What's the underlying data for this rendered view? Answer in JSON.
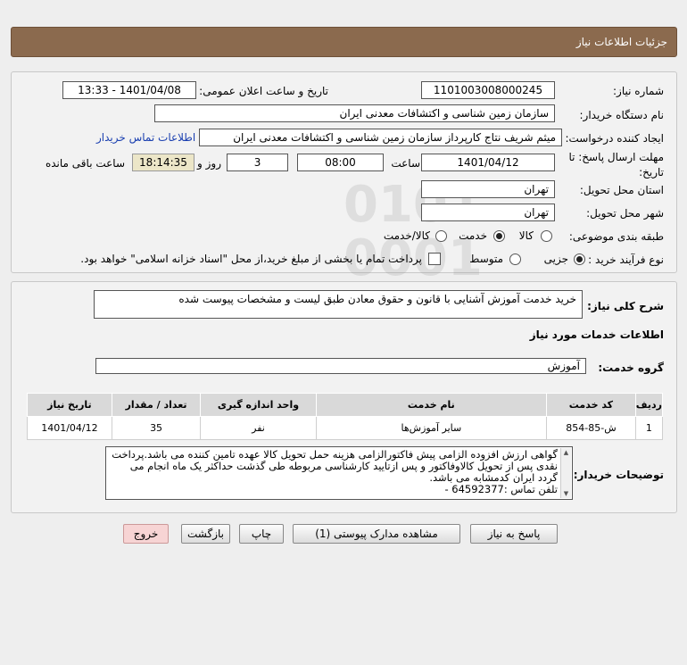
{
  "header": {
    "title": "جزئیات اطلاعات نیاز"
  },
  "need": {
    "number_label": "شماره نیاز:",
    "number": "1101003008000245",
    "announce_label": "تاریخ و ساعت اعلان عمومی:",
    "announce": "1401/04/08 - 13:33",
    "buyer_label": "نام دستگاه خریدار:",
    "buyer": "سازمان زمین شناسی و اکتشافات معدنی ایران",
    "creator_label": "ایجاد کننده درخواست:",
    "creator": "میثم شریف نتاج کارپرداز سازمان زمین شناسی و اکتشافات معدنی ایران",
    "contact_link": "اطلاعات تماس خریدار",
    "deadline_label_1": "مهلت ارسال پاسخ: تا",
    "deadline_label_2": "تاریخ:",
    "deadline_date": "1401/04/12",
    "time_label": "ساعت",
    "deadline_time": "08:00",
    "days": "3",
    "days_label": "روز و",
    "remaining": "18:14:35",
    "remaining_label": "ساعت باقی مانده",
    "province_label": "استان محل تحویل:",
    "province": "تهران",
    "city_label": "شهر محل تحویل:",
    "city": "تهران",
    "category_label": "طبقه بندی موضوعی:",
    "category_options": [
      "کالا",
      "خدمت",
      "کالا/خدمت"
    ],
    "category_selected": 1,
    "process_label": "نوع فرآیند خرید :",
    "process_options": [
      "جزیی",
      "متوسط"
    ],
    "process_selected": 0,
    "payment_note": "پرداخت تمام یا بخشی از مبلغ خرید،از محل \"اسناد خزانه اسلامی\" خواهد بود."
  },
  "summary": {
    "label": "شرح کلی نیاز:",
    "text": "خرید خدمت آموزش آشنایی با قانون و حقوق معادن طبق لیست و مشخصات پیوست شده",
    "services_title": "اطلاعات خدمات مورد نیاز",
    "group_label": "گروه خدمت:",
    "group": "آموزش"
  },
  "table": {
    "headers": [
      "ردیف",
      "کد خدمت",
      "نام خدمت",
      "واحد اندازه گیری",
      "تعداد / مقدار",
      "تاریخ نیاز"
    ],
    "rows": [
      [
        "1",
        "ش-85-854",
        "سایر آموزش‌ها",
        "نفر",
        "35",
        "1401/04/12"
      ]
    ]
  },
  "buyer_notes": {
    "label": "توضیحات خریدار:",
    "text": "گواهی ارزش افزوده الزامی پیش فاکتورالزامی هزینه حمل تحویل کالا عهده تامین کننده می باشد.پرداخت نقدی پس از تحویل کالاوفاکتور و پس ازتایید کارشناسی مربوطه طی گذشت حداکثر یک ماه انجام می گردد ایران کدمشابه می باشد.",
    "phone": "تلفن تماس :64592377 -"
  },
  "buttons": {
    "reply": "پاسخ به نیاز",
    "docs": "مشاهده مدارک پیوستی (1)",
    "print": "چاپ",
    "back": "بازگشت",
    "exit": "خروج"
  },
  "colors": {
    "header": "#8b6a4e",
    "link": "#1a3fb0",
    "remaining_bg": "#ece6c8",
    "exit_bg": "#f7d4d4"
  }
}
